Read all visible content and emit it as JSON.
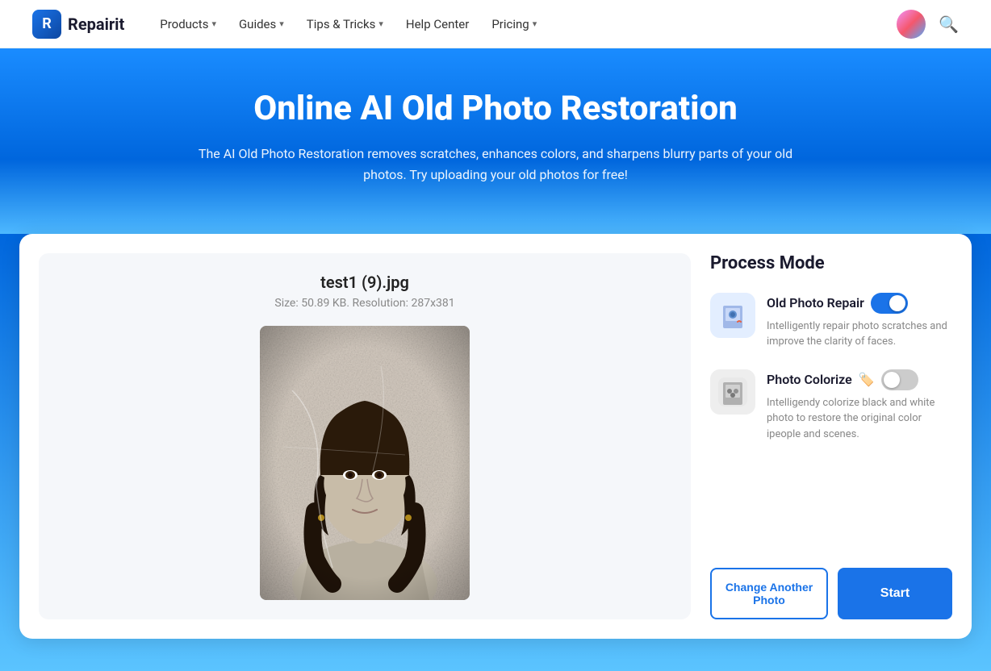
{
  "brand": {
    "logo_text": "R",
    "name": "Repairit"
  },
  "nav": {
    "items": [
      {
        "label": "Products",
        "has_chevron": true
      },
      {
        "label": "Guides",
        "has_chevron": true
      },
      {
        "label": "Tips & Tricks",
        "has_chevron": true
      },
      {
        "label": "Help Center",
        "has_chevron": false
      },
      {
        "label": "Pricing",
        "has_chevron": true
      }
    ]
  },
  "hero": {
    "title": "Online AI Old Photo Restoration",
    "subtitle": "The AI Old Photo Restoration removes scratches, enhances colors, and sharpens blurry parts of your old photos. Try uploading your old photos for free!"
  },
  "left_panel": {
    "file_name": "test1 (9).jpg",
    "file_meta": "Size: 50.89 KB. Resolution: 287x381"
  },
  "right_panel": {
    "process_mode_title": "Process Mode",
    "modes": [
      {
        "label": "Old Photo Repair",
        "badge": "",
        "desc": "Intelligently repair photo scratches and improve the clarity of faces.",
        "enabled": true,
        "icon": "🖼️"
      },
      {
        "label": "Photo Colorize",
        "badge": "🏷️",
        "desc": "Intelligendy colorize black and white photo to restore the original color ipeople and scenes.",
        "enabled": false,
        "icon": "🎨"
      }
    ],
    "change_photo_label": "Change Another Photo",
    "start_label": "Start"
  }
}
